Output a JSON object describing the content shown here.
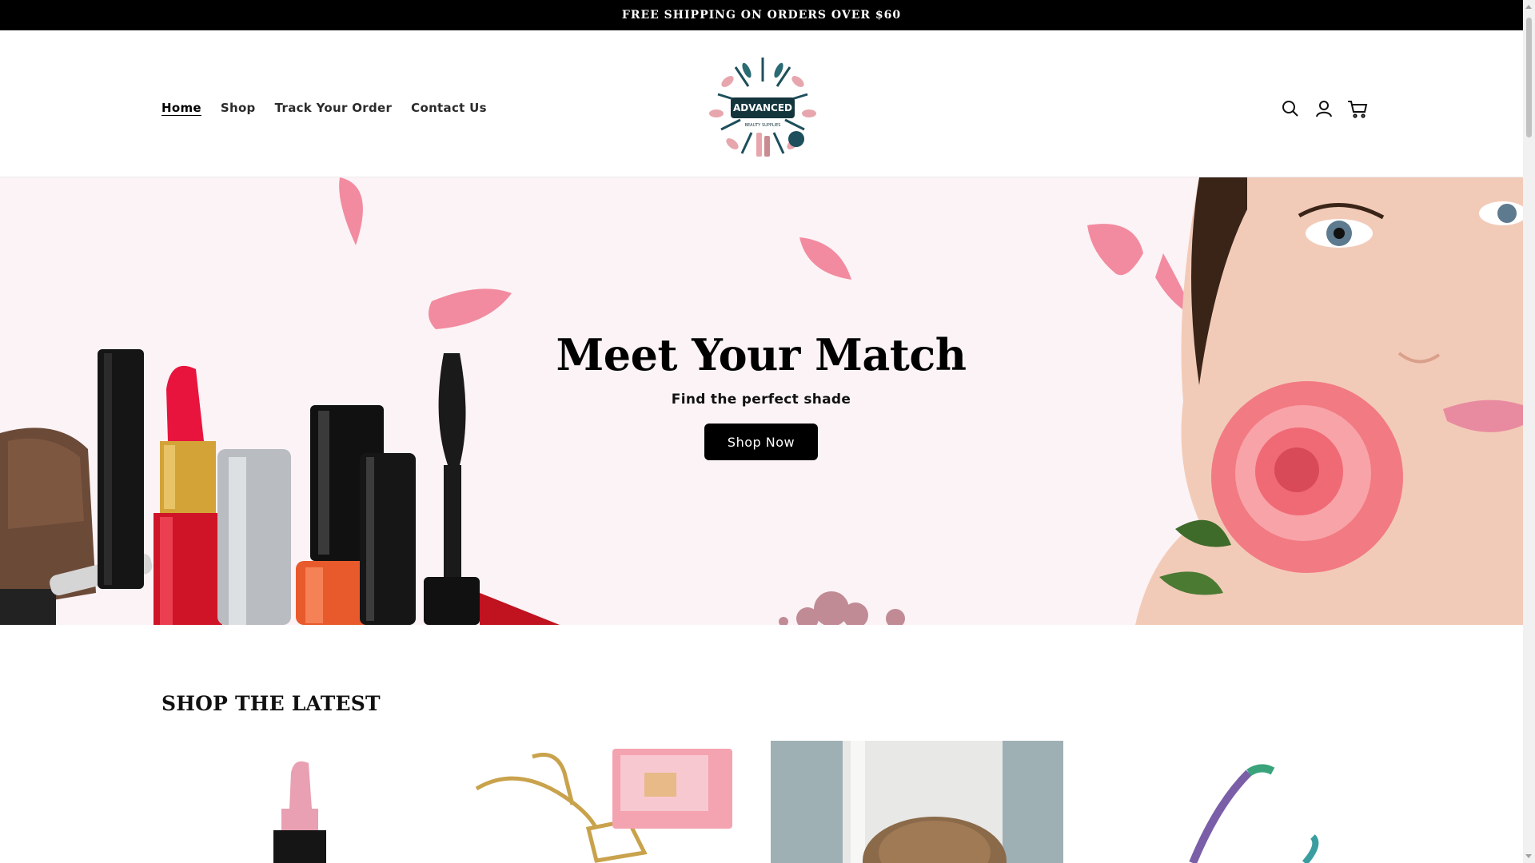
{
  "announcement": {
    "text": "FREE SHIPPING ON ORDERS OVER $60"
  },
  "header": {
    "nav": [
      {
        "label": "Home",
        "active": true
      },
      {
        "label": "Shop",
        "active": false
      },
      {
        "label": "Track Your Order",
        "active": false
      },
      {
        "label": "Contact Us",
        "active": false
      }
    ],
    "logo": {
      "text": "ADVANCED",
      "subtext": "BEAUTY SUPPLIES"
    },
    "icons": [
      "search-icon",
      "account-icon",
      "cart-icon"
    ]
  },
  "hero": {
    "title": "Meet Your Match",
    "subtitle": "Find the perfect shade",
    "button_label": "Shop Now"
  },
  "latest": {
    "title": "SHOP THE LATEST",
    "products": [
      {
        "name": "lipstick"
      },
      {
        "name": "hair-claw-clips-set"
      },
      {
        "name": "crochet-bucket-hat"
      },
      {
        "name": "eyelash-curler"
      }
    ]
  },
  "colors": {
    "accent": "#000000",
    "hero_bg": "#fcf3f6",
    "petal": "#f28ba0"
  }
}
